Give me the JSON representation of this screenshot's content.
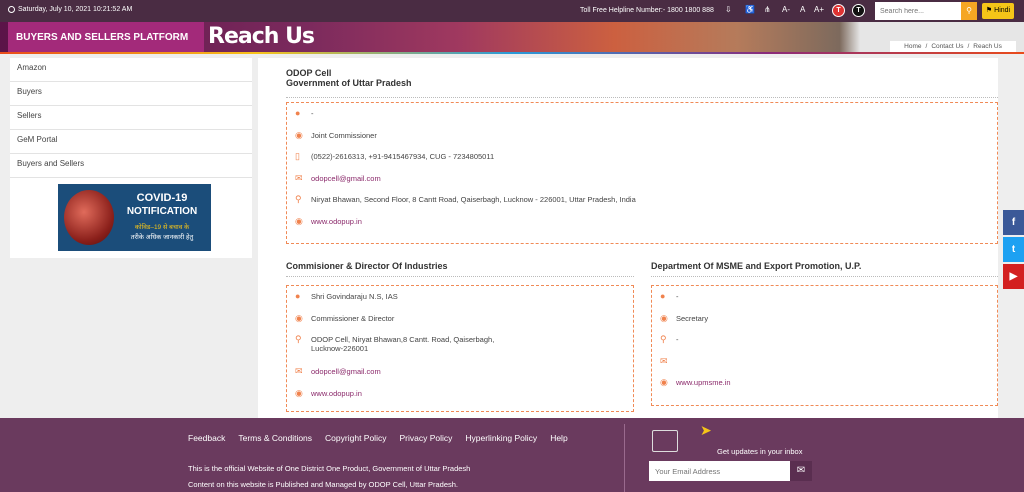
{
  "topbar": {
    "date": "Saturday, July 10, 2021 10:21:52 AM",
    "helpline": "Toll Free Helpline Number:- 1800 1800 888",
    "font_smaller": "A-",
    "font_normal": "A",
    "font_larger": "A+",
    "theme_dark": "T",
    "theme_light": "T",
    "search_placeholder": "Search here...",
    "hindi_label": "Hindi"
  },
  "banner": {
    "platform": "BUYERS AND SELLERS PLATFORM",
    "title": "Reach Us",
    "breadcrumb": [
      "Home",
      "/",
      "Contact Us",
      "/",
      "Reach Us"
    ]
  },
  "sidebar": {
    "items": [
      {
        "label": "Amazon"
      },
      {
        "label": "Buyers"
      },
      {
        "label": "Sellers"
      },
      {
        "label": "GeM Portal"
      },
      {
        "label": "Buyers and Sellers"
      }
    ],
    "covid": {
      "line1": "COVID-19",
      "line2": "NOTIFICATION",
      "line3": "कोविड–19 से बचाव के",
      "line4": "तरीके अधिक जानकारी हेतु"
    }
  },
  "main": {
    "odop": {
      "heading1": "ODOP Cell",
      "heading2": "Government of Uttar Pradesh",
      "name": "-",
      "designation": "Joint Commissioner",
      "phone": "(0522)-2616313, +91-9415467934, CUG - 7234805011",
      "email": "odopcell@gmail.com",
      "address": "Niryat Bhawan, Second Floor, 8 Cantt Road, Qaiserbagh, Lucknow - 226001, Uttar Pradesh, India",
      "website": "www.odopup.in"
    },
    "commissioner": {
      "heading": "Commisioner & Director Of Industries",
      "name": "Shri Govindaraju N.S, IAS",
      "designation": "Commissioner & Director",
      "address_line1": "ODOP Cell, Niryat Bhawan,8 Cantt. Road, Qaiserbagh,",
      "address_line2": "Lucknow-226001",
      "email": "odopcell@gmail.com",
      "website": "www.odopup.in"
    },
    "msme": {
      "heading": "Department Of MSME and Export Promotion, U.P.",
      "name": "-",
      "designation": "Secretary",
      "address": "-",
      "email": "",
      "website": "www.upmsme.in"
    }
  },
  "social": {
    "facebook": "f",
    "twitter": "t",
    "youtube": "▶"
  },
  "footer": {
    "links": [
      "Feedback",
      "Terms & Conditions",
      "Copyright Policy",
      "Privacy Policy",
      "Hyperlinking Policy",
      "Help"
    ],
    "info1": "This is the official Website of One District One Product, Government of Uttar Pradesh",
    "info2": "Content on this website is Published and Managed by ODOP Cell, Uttar Pradesh.",
    "updates": "Get updates in your inbox",
    "email_placeholder": "Your Email Address"
  },
  "colors": {
    "topbar": "#4a2c43",
    "platform": "#a32a7a",
    "accent": "#f0824d",
    "link": "#8b2a6b",
    "footer": "#6a3a5e"
  }
}
